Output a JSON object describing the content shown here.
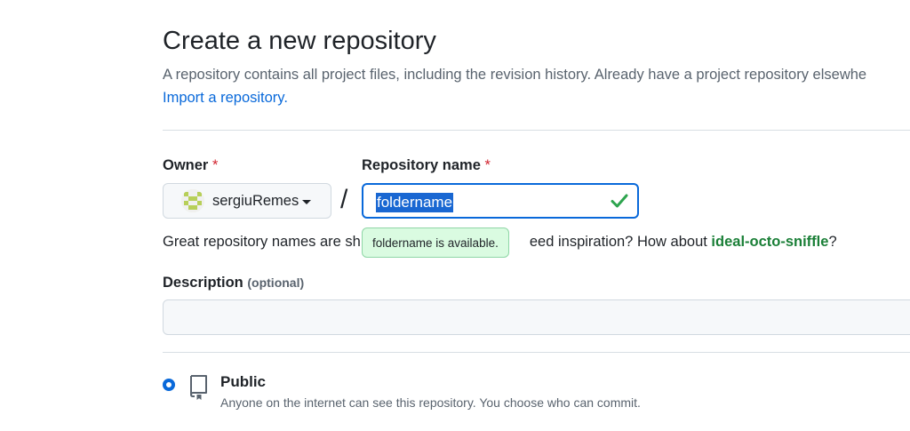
{
  "page": {
    "title": "Create a new repository",
    "subtitle": "A repository contains all project files, including the revision history. Already have a project repository elsewhe",
    "import_link": "Import a repository."
  },
  "owner": {
    "label": "Owner",
    "required_mark": "*",
    "value": "sergiuRemes"
  },
  "slash": "/",
  "repo_name": {
    "label": "Repository name",
    "required_mark": "*",
    "value": "foldername",
    "valid_icon": "check-icon",
    "tooltip": "foldername is available."
  },
  "hint": {
    "text_before": "Great repository names are sh",
    "text_middle": "eed inspiration? How about ",
    "suggestion": "ideal-octo-sniffle",
    "text_after": "?"
  },
  "description": {
    "label": "Description",
    "optional": "(optional)",
    "value": ""
  },
  "visibility": {
    "public_label": "Public",
    "public_desc": "Anyone on the internet can see this repository. You choose who can commit.",
    "selected": "public",
    "icon": "repo-icon"
  },
  "colors": {
    "accent": "#0969da",
    "success": "#1a7f37",
    "required": "#d1242f"
  }
}
